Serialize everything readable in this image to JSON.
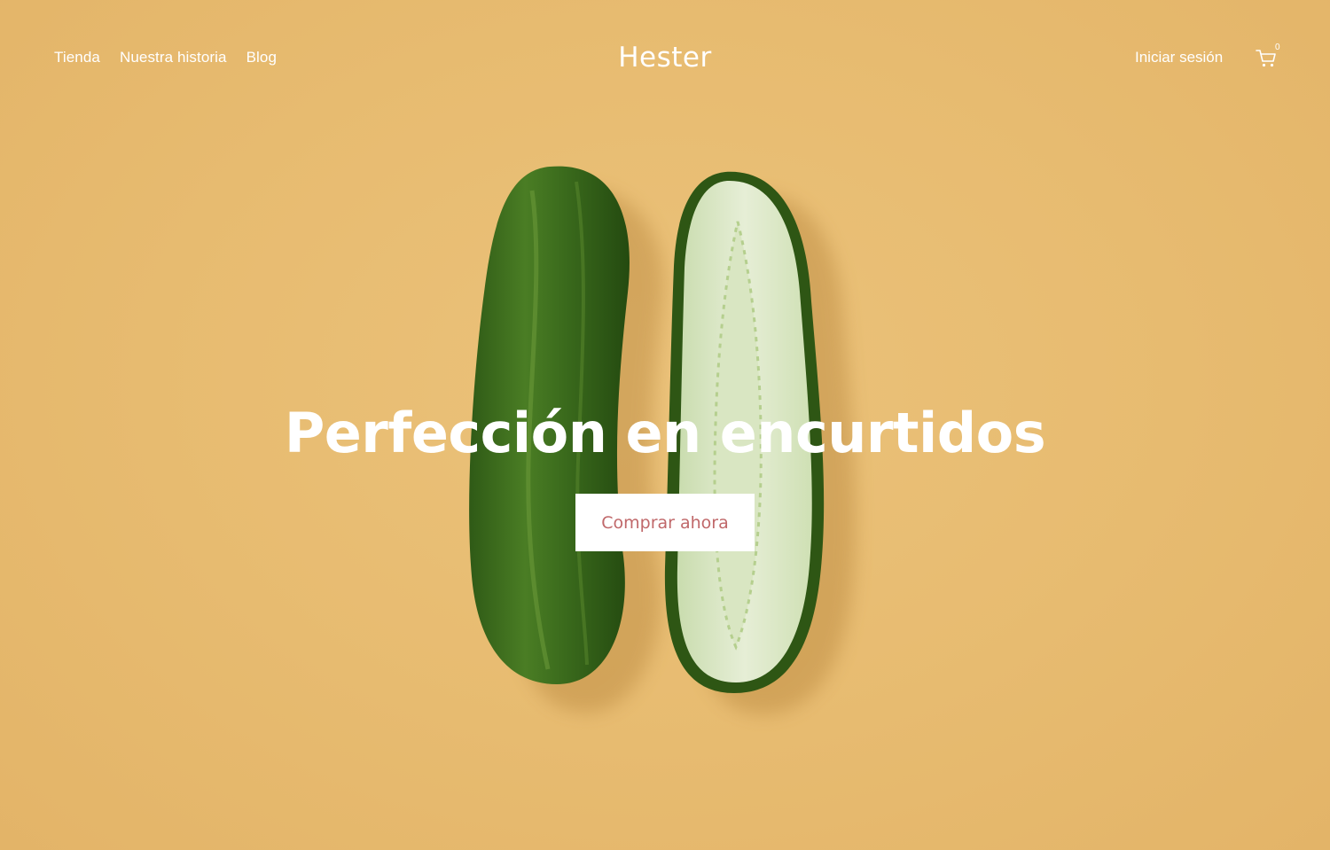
{
  "header": {
    "nav": [
      {
        "label": "Tienda"
      },
      {
        "label": "Nuestra historia"
      },
      {
        "label": "Blog"
      }
    ],
    "brand": "Hester",
    "login_label": "Iniciar sesión",
    "cart": {
      "icon": "cart-icon",
      "count": "0"
    }
  },
  "hero": {
    "headline": "Perfección en encurtidos",
    "cta_label": "Comprar ahora",
    "image": "two-cucumbers-whole-and-halved"
  },
  "colors": {
    "background": "#e8bc72",
    "text": "#ffffff",
    "cta_text": "#c0686a",
    "cta_bg": "#ffffff"
  }
}
